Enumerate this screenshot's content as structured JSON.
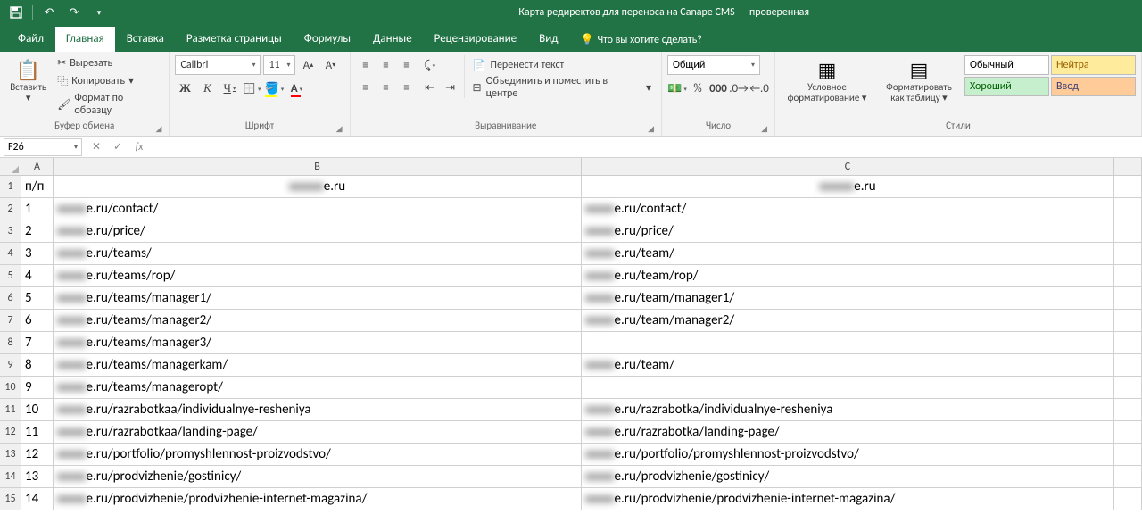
{
  "title": "Карта редиректов для переноса на Canape CMS — проверенная",
  "qat": {
    "save": "💾",
    "undo": "↶",
    "redo": "↷"
  },
  "tabs": {
    "file": "Файл",
    "home": "Главная",
    "insert": "Вставка",
    "layout": "Разметка страницы",
    "formulas": "Формулы",
    "data": "Данные",
    "review": "Рецензирование",
    "view": "Вид",
    "tell": "Что вы хотите сделать?"
  },
  "ribbon": {
    "clipboard": {
      "paste": "Вставить",
      "cut": "Вырезать",
      "copy": "Копировать",
      "formatpainter": "Формат по образцу",
      "label": "Буфер обмена"
    },
    "font": {
      "name": "Calibri",
      "size": "11",
      "label": "Шрифт"
    },
    "alignment": {
      "wrap": "Перенести текст",
      "merge": "Объединить и поместить в центре",
      "label": "Выравнивание"
    },
    "number": {
      "format": "Общий",
      "label": "Число"
    },
    "styles": {
      "condformat": "Условное форматирование",
      "astable": "Форматировать как таблицу",
      "normal": "Обычный",
      "neutral": "Нейтра",
      "good": "Хороший",
      "input": "Ввод",
      "label": "Стили"
    }
  },
  "namebox": "F26",
  "columns": [
    "A",
    "B",
    "C"
  ],
  "headerRow": {
    "a": "п/п",
    "b": "e.ru",
    "c": "e.ru"
  },
  "rows": [
    {
      "n": "1",
      "b": "e.ru/contact/",
      "c": "e.ru/contact/"
    },
    {
      "n": "2",
      "b": "e.ru/price/",
      "c": "e.ru/price/"
    },
    {
      "n": "3",
      "b": "e.ru/teams/",
      "c": "e.ru/team/"
    },
    {
      "n": "4",
      "b": "e.ru/teams/rop/",
      "c": "e.ru/team/rop/"
    },
    {
      "n": "5",
      "b": "e.ru/teams/manager1/",
      "c": "e.ru/team/manager1/"
    },
    {
      "n": "6",
      "b": "e.ru/teams/manager2/",
      "c": "e.ru/team/manager2/"
    },
    {
      "n": "7",
      "b": "e.ru/teams/manager3/",
      "c": ""
    },
    {
      "n": "8",
      "b": "e.ru/teams/managerkam/",
      "c": "e.ru/team/"
    },
    {
      "n": "9",
      "b": "e.ru/teams/manageropt/",
      "c": ""
    },
    {
      "n": "10",
      "b": "e.ru/razrabotkaa/individualnye-resheniya",
      "c": "e.ru/razrabotka/individualnye-resheniya"
    },
    {
      "n": "11",
      "b": "e.ru/razrabotkaa/landing-page/",
      "c": "e.ru/razrabotka/landing-page/"
    },
    {
      "n": "12",
      "b": "e.ru/portfolio/promyshlennost-proizvodstvo/",
      "c": "e.ru/portfolio/promyshlennost-proizvodstvo/"
    },
    {
      "n": "13",
      "b": "e.ru/prodvizhenie/gostinicy/",
      "c": "e.ru/prodvizhenie/gostinicy/"
    },
    {
      "n": "14",
      "b": "e.ru/prodvizhenie/prodvizhenie-internet-magazina/",
      "c": "e.ru/prodvizhenie/prodvizhenie-internet-magazina/"
    }
  ]
}
